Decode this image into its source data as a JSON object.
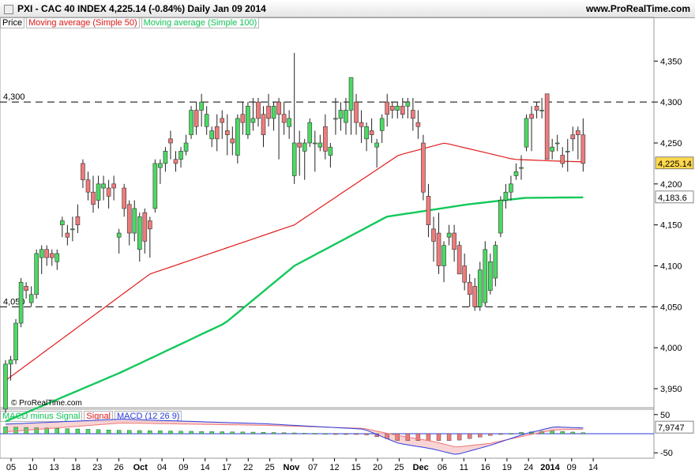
{
  "header": {
    "title": "PXI - CAC 40 INDEX     4,225.14 (-0.84%)     Daily  Jan 09 2014",
    "site": "www.ProRealTime.com"
  },
  "price_legend": [
    "Price",
    "Moving average (Simple 50)",
    "Moving average (Simple 100)"
  ],
  "macd_legend": [
    "MACD minus Signal",
    "Signal",
    "MACD (12 26 9)"
  ],
  "watermark": "© ProRealTime.com",
  "colors": {
    "bull": "#4cd964",
    "bear": "#ef7b7b",
    "ma50": "#e21b1b",
    "ma100": "#14c85a",
    "macd": "#2d3ee0",
    "signal": "#ee7777"
  },
  "chart_data": [
    {
      "type": "candlestick",
      "title": "PXI - CAC 40 INDEX",
      "ylim": [
        3900,
        4380
      ],
      "y_ticks": [
        3950,
        4000,
        4050,
        4100,
        4150,
        4200,
        4250,
        4300,
        4350
      ],
      "y_tick_labels": [
        "3,950",
        "4,000",
        "4,050",
        "4,100",
        "4,150",
        "4,200",
        "4,250",
        "4,300",
        "4,350"
      ],
      "hlines": [
        {
          "value": 4300,
          "label": "4,300"
        },
        {
          "value": 4050,
          "label": "4,050"
        }
      ],
      "last_price": {
        "value": 4225.14,
        "label": "4,225.14"
      },
      "ma100_last": {
        "value": 4183.6,
        "label": "4,183.6"
      },
      "x_tick_labels": [
        "05",
        "10",
        "13",
        "18",
        "23",
        "26",
        "Oct",
        "04",
        "09",
        "14",
        "17",
        "22",
        "25",
        "Nov",
        "07",
        "12",
        "15",
        "20",
        "25",
        "Dec",
        "06",
        "11",
        "16",
        "19",
        "24",
        "2014",
        "09",
        "14"
      ],
      "x_bold_labels": [
        "Oct",
        "Nov",
        "Dec",
        "2014"
      ],
      "candles": [
        [
          3925,
          3985,
          3920,
          3980
        ],
        [
          3980,
          3990,
          3960,
          3985
        ],
        [
          3985,
          4035,
          3980,
          4030
        ],
        [
          4030,
          4085,
          4025,
          4080
        ],
        [
          4075,
          4080,
          4060,
          4070
        ],
        [
          4055,
          4075,
          4050,
          4065
        ],
        [
          4065,
          4120,
          4060,
          4115
        ],
        [
          4110,
          4125,
          4090,
          4120
        ],
        [
          4120,
          4125,
          4100,
          4110
        ],
        [
          4115,
          4120,
          4100,
          4110
        ],
        [
          4105,
          4120,
          4095,
          4115
        ],
        [
          4150,
          4160,
          4135,
          4155
        ],
        [
          4140,
          4150,
          4125,
          4135
        ],
        [
          4145,
          4160,
          4130,
          4145
        ],
        [
          4160,
          4175,
          4140,
          4150
        ],
        [
          4225,
          4230,
          4195,
          4205
        ],
        [
          4205,
          4215,
          4180,
          4190
        ],
        [
          4190,
          4210,
          4165,
          4175
        ],
        [
          4180,
          4210,
          4170,
          4200
        ],
        [
          4195,
          4210,
          4180,
          4200
        ],
        [
          4195,
          4205,
          4170,
          4185
        ],
        [
          4200,
          4210,
          4180,
          4195
        ],
        [
          4135,
          4145,
          4115,
          4140
        ],
        [
          4195,
          4200,
          4160,
          4170
        ],
        [
          4175,
          4180,
          4125,
          4140
        ],
        [
          4140,
          4180,
          4130,
          4170
        ],
        [
          4120,
          4165,
          4105,
          4160
        ],
        [
          4165,
          4170,
          4115,
          4130
        ],
        [
          4155,
          4160,
          4110,
          4145
        ],
        [
          4170,
          4230,
          4165,
          4225
        ],
        [
          4220,
          4230,
          4200,
          4225
        ],
        [
          4225,
          4245,
          4215,
          4240
        ],
        [
          4255,
          4265,
          4230,
          4250
        ],
        [
          4230,
          4240,
          4215,
          4225
        ],
        [
          4230,
          4245,
          4220,
          4240
        ],
        [
          4240,
          4260,
          4235,
          4250
        ],
        [
          4260,
          4295,
          4255,
          4290
        ],
        [
          4290,
          4300,
          4260,
          4270
        ],
        [
          4290,
          4310,
          4270,
          4300
        ],
        [
          4270,
          4295,
          4260,
          4285
        ],
        [
          4255,
          4270,
          4245,
          4265
        ],
        [
          4270,
          4285,
          4240,
          4255
        ],
        [
          4280,
          4290,
          4255,
          4275
        ],
        [
          4265,
          4285,
          4235,
          4260
        ],
        [
          4255,
          4270,
          4235,
          4250
        ],
        [
          4235,
          4285,
          4225,
          4280
        ],
        [
          4285,
          4300,
          4260,
          4275
        ],
        [
          4260,
          4300,
          4255,
          4295
        ],
        [
          4275,
          4305,
          4265,
          4280
        ],
        [
          4300,
          4305,
          4270,
          4280
        ],
        [
          4285,
          4295,
          4245,
          4260
        ],
        [
          4295,
          4310,
          4270,
          4280
        ],
        [
          4280,
          4300,
          4265,
          4295
        ],
        [
          4300,
          4305,
          4230,
          4285
        ],
        [
          4285,
          4300,
          4260,
          4275
        ],
        [
          4270,
          4290,
          4255,
          4280
        ],
        [
          4210,
          4360,
          4200,
          4250
        ],
        [
          4250,
          4265,
          4210,
          4245
        ],
        [
          4240,
          4255,
          4205,
          4250
        ],
        [
          4250,
          4280,
          4245,
          4275
        ],
        [
          4250,
          4265,
          4215,
          4250
        ],
        [
          4245,
          4260,
          4240,
          4250
        ],
        [
          4270,
          4285,
          4230,
          4240
        ],
        [
          4235,
          4250,
          4220,
          4245
        ],
        [
          4280,
          4305,
          4260,
          4280
        ],
        [
          4280,
          4300,
          4265,
          4290
        ],
        [
          4275,
          4305,
          4260,
          4290
        ],
        [
          4290,
          4325,
          4260,
          4330
        ],
        [
          4300,
          4310,
          4260,
          4275
        ],
        [
          4275,
          4290,
          4250,
          4270
        ],
        [
          4255,
          4275,
          4240,
          4270
        ],
        [
          4265,
          4280,
          4250,
          4260
        ],
        [
          4245,
          4255,
          4220,
          4250
        ],
        [
          4265,
          4285,
          4250,
          4280
        ],
        [
          4300,
          4310,
          4270,
          4285
        ],
        [
          4295,
          4300,
          4280,
          4290
        ],
        [
          4290,
          4300,
          4280,
          4295
        ],
        [
          4295,
          4305,
          4280,
          4285
        ],
        [
          4295,
          4305,
          4280,
          4300
        ],
        [
          4290,
          4305,
          4265,
          4280
        ],
        [
          4275,
          4290,
          4255,
          4270
        ],
        [
          4250,
          4260,
          4180,
          4190
        ],
        [
          4185,
          4200,
          4135,
          4150
        ],
        [
          4145,
          4160,
          4105,
          4130
        ],
        [
          4140,
          4165,
          4090,
          4100
        ],
        [
          4100,
          4130,
          4080,
          4125
        ],
        [
          4135,
          4150,
          4125,
          4140
        ],
        [
          4140,
          4150,
          4105,
          4120
        ],
        [
          4125,
          4130,
          4090,
          4090
        ],
        [
          4100,
          4115,
          4070,
          4080
        ],
        [
          4080,
          4090,
          4050,
          4065
        ],
        [
          4075,
          4085,
          4045,
          4050
        ],
        [
          4050,
          4105,
          4045,
          4095
        ],
        [
          4055,
          4130,
          4050,
          4120
        ],
        [
          4070,
          4115,
          4065,
          4105
        ],
        [
          4085,
          4130,
          4075,
          4125
        ],
        [
          4140,
          4185,
          4135,
          4180
        ],
        [
          4180,
          4200,
          4170,
          4190
        ],
        [
          4190,
          4210,
          4180,
          4200
        ],
        [
          4210,
          4225,
          4205,
          4215
        ],
        [
          4220,
          4235,
          4205,
          4220
        ],
        [
          4245,
          4285,
          4240,
          4280
        ],
        [
          4285,
          4295,
          4240,
          4280
        ],
        [
          4295,
          4300,
          4280,
          4290
        ],
        [
          4290,
          4305,
          4280,
          4290
        ],
        [
          4310,
          4310,
          4230,
          4230
        ],
        [
          4240,
          4255,
          4230,
          4245
        ],
        [
          4250,
          4260,
          4240,
          4250
        ],
        [
          4235,
          4245,
          4220,
          4225
        ],
        [
          4240,
          4255,
          4215,
          4240
        ],
        [
          4260,
          4270,
          4240,
          4255
        ],
        [
          4265,
          4270,
          4230,
          4260
        ],
        [
          4260,
          4280,
          4215,
          4225
        ]
      ],
      "ma50": {
        "name": "Moving average (Simple 50)",
        "last": 4227
      },
      "ma100": {
        "name": "Moving average (Simple 100)",
        "last": 4183.6
      }
    },
    {
      "type": "bar",
      "title": "MACD (12 26 9)",
      "ylim": [
        -60,
        65
      ],
      "y_ticks": [
        50,
        -50
      ],
      "y_tick_labels": [
        "50",
        "-50"
      ],
      "last_value": {
        "value": 7.9747,
        "label": "7,9747"
      }
    }
  ]
}
